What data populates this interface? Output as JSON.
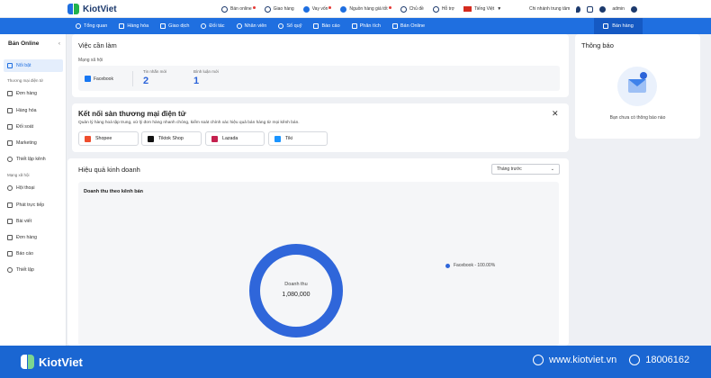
{
  "app": {
    "logo_text": "KiotViet"
  },
  "topbar": {
    "links": [
      {
        "label": "Bán online",
        "badge": true
      },
      {
        "label": "Giao hàng",
        "badge": false
      },
      {
        "label": "Vay vốn",
        "badge": true
      },
      {
        "label": "Nguồn hàng giá tốt",
        "badge": true
      },
      {
        "label": "Chủ đề",
        "badge": false
      },
      {
        "label": "Hỗ trợ",
        "badge": false
      },
      {
        "label": "Tiếng Việt",
        "badge": false
      }
    ],
    "branch": "Chi nhánh trung tâm",
    "user": "admin"
  },
  "nav": {
    "items": [
      "Tổng quan",
      "Hàng hóa",
      "Giao dịch",
      "Đối tác",
      "Nhân viên",
      "Sổ quỹ",
      "Báo cáo",
      "Phân tích",
      "Bán Online"
    ],
    "sell_button": "Bán hàng"
  },
  "sidebar": {
    "title": "Bán Online",
    "items_top": [
      "Nổi bật"
    ],
    "section1": "Thương mại điện tử",
    "items1": [
      "Đơn hàng",
      "Hàng hóa",
      "Đối soát",
      "Marketing",
      "Thiết lập kênh"
    ],
    "section2": "Mạng xã hội",
    "items2": [
      "Hội thoại",
      "Phát trực tiếp",
      "Bài viết",
      "Đơn hàng",
      "Báo cáo",
      "Thiết lập"
    ]
  },
  "tasks": {
    "title": "Việc cần làm",
    "subtitle": "Mạng xã hội",
    "channel": "Facebook",
    "stats": [
      {
        "label": "Tin nhắn mới",
        "value": "2"
      },
      {
        "label": "Bình luận mới",
        "value": "1"
      }
    ]
  },
  "notifications": {
    "title": "Thông báo",
    "empty_text": "Bạn chưa có thông báo nào"
  },
  "connect": {
    "title": "Kết nối sàn thương mại điện tử",
    "description": "Quản lý hàng hoá tập trung, xử lý đơn hàng nhanh chóng, kiểm soát chính xác hiệu quả bán hàng từ mọi kênh bán.",
    "shops": [
      {
        "label": "Shopee",
        "color": "#ee4d2d"
      },
      {
        "label": "Tiktok Shop",
        "color": "#111111"
      },
      {
        "label": "Lazada",
        "color": "#c4204e"
      },
      {
        "label": "Tiki",
        "color": "#1a94ff"
      }
    ]
  },
  "performance": {
    "title": "Hiệu quả kinh doanh",
    "period": "Tháng trước",
    "panel_title": "Doanh thu theo kênh bán",
    "center_label": "Doanh thu",
    "center_value": "1,080,000",
    "legend": "Facebook - 100.00%"
  },
  "chart_data": {
    "type": "pie",
    "categories": [
      "Facebook"
    ],
    "values": [
      100.0
    ],
    "title": "Doanh thu theo kênh bán",
    "colors": [
      "#2f66da"
    ]
  },
  "footer": {
    "logo_text": "KiotViet",
    "website": "www.kiotviet.vn",
    "phone": "18006162"
  }
}
